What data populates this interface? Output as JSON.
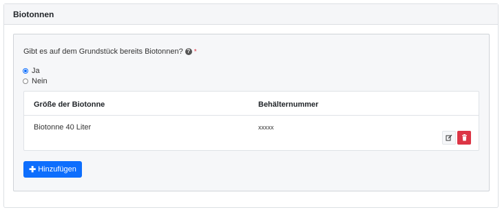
{
  "card": {
    "title": "Biotonnen"
  },
  "form": {
    "question": "Gibt es auf dem Grundstück bereits Biotonnen?",
    "required_mark": "*",
    "options": [
      {
        "label": "Ja",
        "checked": true
      },
      {
        "label": "Nein",
        "checked": false
      }
    ]
  },
  "table": {
    "headers": [
      "Größe der Biotonne",
      "Behälternummer"
    ],
    "rows": [
      {
        "size": "Biotonne 40 Liter",
        "number": "xxxxx"
      }
    ]
  },
  "actions": {
    "add_label": "Hinzufügen"
  },
  "colors": {
    "primary": "#0d6efd",
    "danger": "#dc3545"
  },
  "icons": {
    "help": "question-circle-icon",
    "edit": "edit-icon",
    "delete": "trash-icon",
    "add": "plus-icon"
  }
}
